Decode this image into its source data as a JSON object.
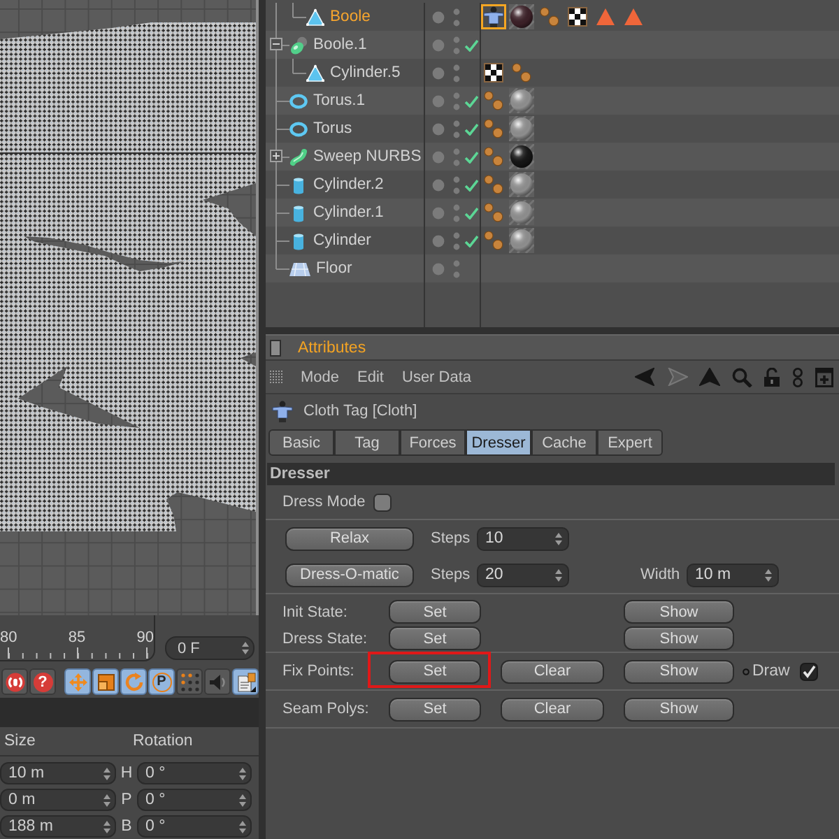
{
  "objects": [
    {
      "children": [
        {
          "name": "Boole",
          "kind": "polygon",
          "selected": true,
          "tags": [
            {
              "kind": "cloth",
              "selected": true
            },
            {
              "kind": "material",
              "color": "#3b2027",
              "selected": false
            },
            {
              "kind": "beads",
              "selected": false
            },
            {
              "kind": "checker",
              "selected": false
            },
            {
              "kind": "triangle",
              "selected": false
            },
            {
              "kind": "triangle",
              "selected": false
            }
          ]
        }
      ]
    },
    {
      "name": "Boole.1",
      "kind": "boole",
      "selected": false,
      "expanded": true,
      "enabled": true,
      "children": [
        {
          "name": "Cylinder.5",
          "kind": "polygon",
          "selected": false,
          "tags": [
            {
              "kind": "checker",
              "selected": false
            },
            {
              "kind": "beads",
              "selected": false
            }
          ]
        }
      ]
    },
    {
      "name": "Torus.1",
      "kind": "torus",
      "selected": false,
      "enabled": true,
      "tags": [
        {
          "kind": "beads",
          "selected": false
        },
        {
          "kind": "material",
          "color": "#8e8e8e",
          "selected": false
        }
      ]
    },
    {
      "name": "Torus",
      "kind": "torus",
      "selected": false,
      "enabled": true,
      "tags": [
        {
          "kind": "beads",
          "selected": false
        },
        {
          "kind": "material",
          "color": "#8e8e8e",
          "selected": false
        }
      ]
    },
    {
      "name": "Sweep NURBS",
      "kind": "sweep",
      "selected": false,
      "expanded": false,
      "enabled": true,
      "tags": [
        {
          "kind": "beads",
          "selected": false
        },
        {
          "kind": "material",
          "color": "#151515",
          "selected": false
        }
      ]
    },
    {
      "name": "Cylinder.2",
      "kind": "cylinder",
      "selected": false,
      "enabled": true,
      "tags": [
        {
          "kind": "beads",
          "selected": false
        },
        {
          "kind": "material",
          "color": "#8e8e8e",
          "selected": false
        }
      ]
    },
    {
      "name": "Cylinder.1",
      "kind": "cylinder",
      "selected": false,
      "enabled": true,
      "tags": [
        {
          "kind": "beads",
          "selected": false
        },
        {
          "kind": "material",
          "color": "#8e8e8e",
          "selected": false
        }
      ]
    },
    {
      "name": "Cylinder",
      "kind": "cylinder",
      "selected": false,
      "enabled": true,
      "tags": [
        {
          "kind": "beads",
          "selected": false
        },
        {
          "kind": "material",
          "color": "#8e8e8e",
          "selected": false
        }
      ]
    },
    {
      "name": "Floor",
      "kind": "floor",
      "selected": false
    }
  ],
  "attributes": {
    "title": "Attributes",
    "menu": [
      "Mode",
      "Edit",
      "User Data"
    ],
    "nav": [
      {
        "kind": "back",
        "disabled": false
      },
      {
        "kind": "forward",
        "disabled": true
      },
      {
        "kind": "up",
        "disabled": false
      },
      {
        "kind": "search",
        "disabled": false
      },
      {
        "kind": "lock",
        "disabled": false
      },
      {
        "kind": "link",
        "disabled": false
      },
      {
        "kind": "new",
        "disabled": false
      }
    ],
    "object_label": "Cloth Tag [Cloth]",
    "tabs": [
      {
        "label": "Basic",
        "selected": false
      },
      {
        "label": "Tag",
        "selected": false
      },
      {
        "label": "Forces",
        "selected": false
      },
      {
        "label": "Dresser",
        "selected": true
      },
      {
        "label": "Cache",
        "selected": false
      },
      {
        "label": "Expert",
        "selected": false
      }
    ],
    "section": "Dresser",
    "dress_mode": {
      "label": "Dress Mode",
      "checked": false
    },
    "actions": [
      {
        "button": "Relax",
        "steps_label": "Steps",
        "steps": "10"
      },
      {
        "button": "Dress-O-matic",
        "steps_label": "Steps",
        "steps": "20",
        "width_label": "Width",
        "width": "10 m"
      }
    ],
    "state_groups": [
      [
        {
          "label": "Init State:",
          "buttons": [
            {
              "kind": "set",
              "label": "Set",
              "highlighted": false
            },
            {
              "kind": "show",
              "label": "Show",
              "highlighted": false
            }
          ]
        },
        {
          "label": "Dress State:",
          "buttons": [
            {
              "kind": "set",
              "label": "Set",
              "highlighted": false
            },
            {
              "kind": "show",
              "label": "Show",
              "highlighted": false
            }
          ]
        }
      ],
      [
        {
          "label": "Fix Points:",
          "buttons": [
            {
              "kind": "set",
              "label": "Set",
              "highlighted": true
            },
            {
              "kind": "clear",
              "label": "Clear",
              "highlighted": false
            },
            {
              "kind": "show",
              "label": "Show",
              "highlighted": false
            }
          ],
          "draw": {
            "label": "Draw",
            "checked": true
          }
        }
      ],
      [
        {
          "label": "Seam Polys:",
          "buttons": [
            {
              "kind": "set",
              "label": "Set",
              "highlighted": false
            },
            {
              "kind": "clear",
              "label": "Clear",
              "highlighted": false
            },
            {
              "kind": "show",
              "label": "Show",
              "highlighted": false
            }
          ]
        }
      ]
    ]
  },
  "timeline": {
    "labels": [
      "80",
      "85",
      "90"
    ],
    "frame": "0 F"
  },
  "tool_groups": [
    [
      {
        "kind": "record",
        "selected": false
      },
      {
        "kind": "help",
        "glyph": "?",
        "selected": false
      }
    ],
    [
      {
        "kind": "move",
        "selected": true
      },
      {
        "kind": "scale",
        "selected": true
      },
      {
        "kind": "rotate",
        "selected": true
      },
      {
        "kind": "param",
        "glyph": "P",
        "selected": true
      },
      {
        "kind": "points",
        "selected": false
      },
      {
        "kind": "speaker",
        "selected": false
      },
      {
        "kind": "document",
        "selected": true
      }
    ]
  ],
  "coordinates": {
    "headers": [
      "Size",
      "Rotation"
    ],
    "rows": [
      {
        "size": "10 m",
        "axis": "H",
        "rotation": "0 °"
      },
      {
        "size": "0 m",
        "axis": "P",
        "rotation": "0 °"
      },
      {
        "size": "188 m",
        "axis": "B",
        "rotation": "0 °"
      }
    ]
  }
}
